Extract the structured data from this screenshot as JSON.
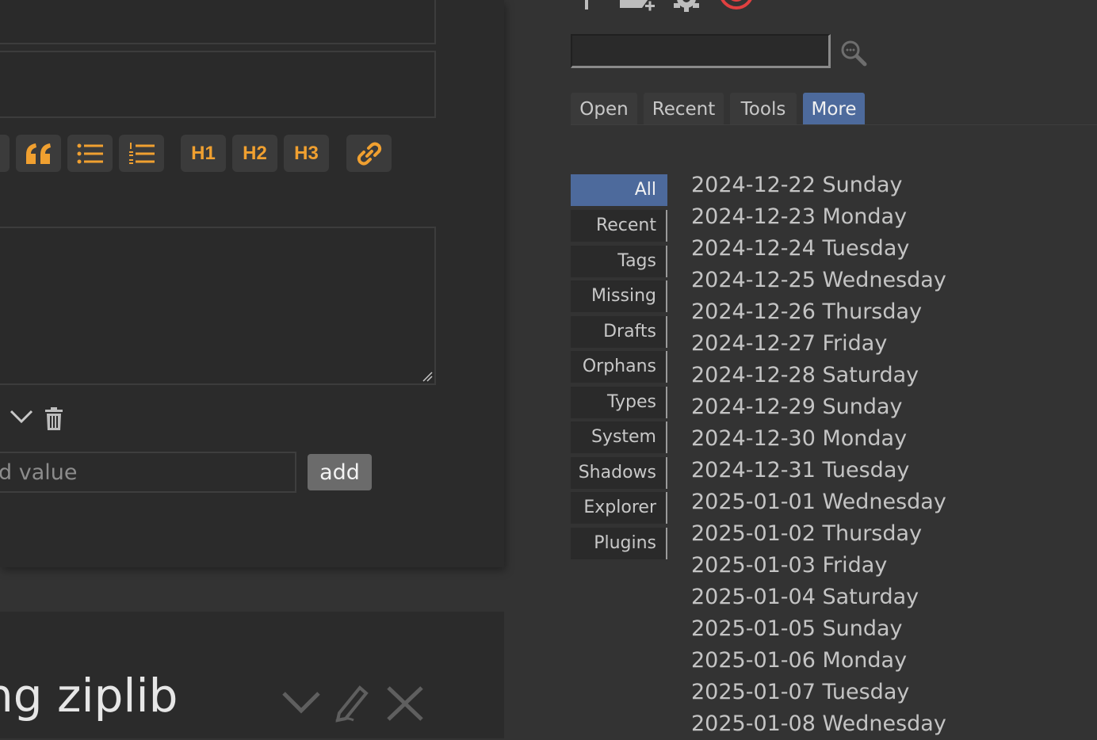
{
  "editor": {
    "toolbar": {
      "heading_labels": [
        "H1",
        "H2",
        "H3"
      ]
    },
    "metadata": {
      "value_placeholder": "d value",
      "add_label": "add"
    }
  },
  "second_note": {
    "title": "ng ziplib"
  },
  "sidebar": {
    "tabs": [
      {
        "label": "Open"
      },
      {
        "label": "Recent"
      },
      {
        "label": "Tools"
      },
      {
        "label": "More",
        "active": true
      }
    ],
    "categories": [
      {
        "label": "All",
        "active": true
      },
      {
        "label": "Recent"
      },
      {
        "label": "Tags"
      },
      {
        "label": "Missing"
      },
      {
        "label": "Drafts"
      },
      {
        "label": "Orphans"
      },
      {
        "label": "Types"
      },
      {
        "label": "System"
      },
      {
        "label": "Shadows"
      },
      {
        "label": "Explorer"
      },
      {
        "label": "Plugins"
      }
    ],
    "dates": [
      "2024-12-22 Sunday",
      "2024-12-23 Monday",
      "2024-12-24 Tuesday",
      "2024-12-25 Wednesday",
      "2024-12-26 Thursday",
      "2024-12-27 Friday",
      "2024-12-28 Saturday",
      "2024-12-29 Sunday",
      "2024-12-30 Monday",
      "2024-12-31 Tuesday",
      "2025-01-01 Wednesday",
      "2025-01-02 Thursday",
      "2025-01-03 Friday",
      "2025-01-04 Saturday",
      "2025-01-05 Sunday",
      "2025-01-06 Monday",
      "2025-01-07 Tuesday",
      "2025-01-08 Wednesday"
    ]
  },
  "colors": {
    "accent_orange": "#f0a030",
    "active_blue": "#4d6a9c",
    "close_red": "#e04040"
  },
  "icons": [
    "quote-icon",
    "bullet-list-icon",
    "numbered-list-icon",
    "link-icon",
    "chevron-down-icon",
    "trash-icon",
    "search-icon",
    "pencil-icon",
    "close-icon",
    "tag-add-icon",
    "gear-icon",
    "target-icon"
  ]
}
